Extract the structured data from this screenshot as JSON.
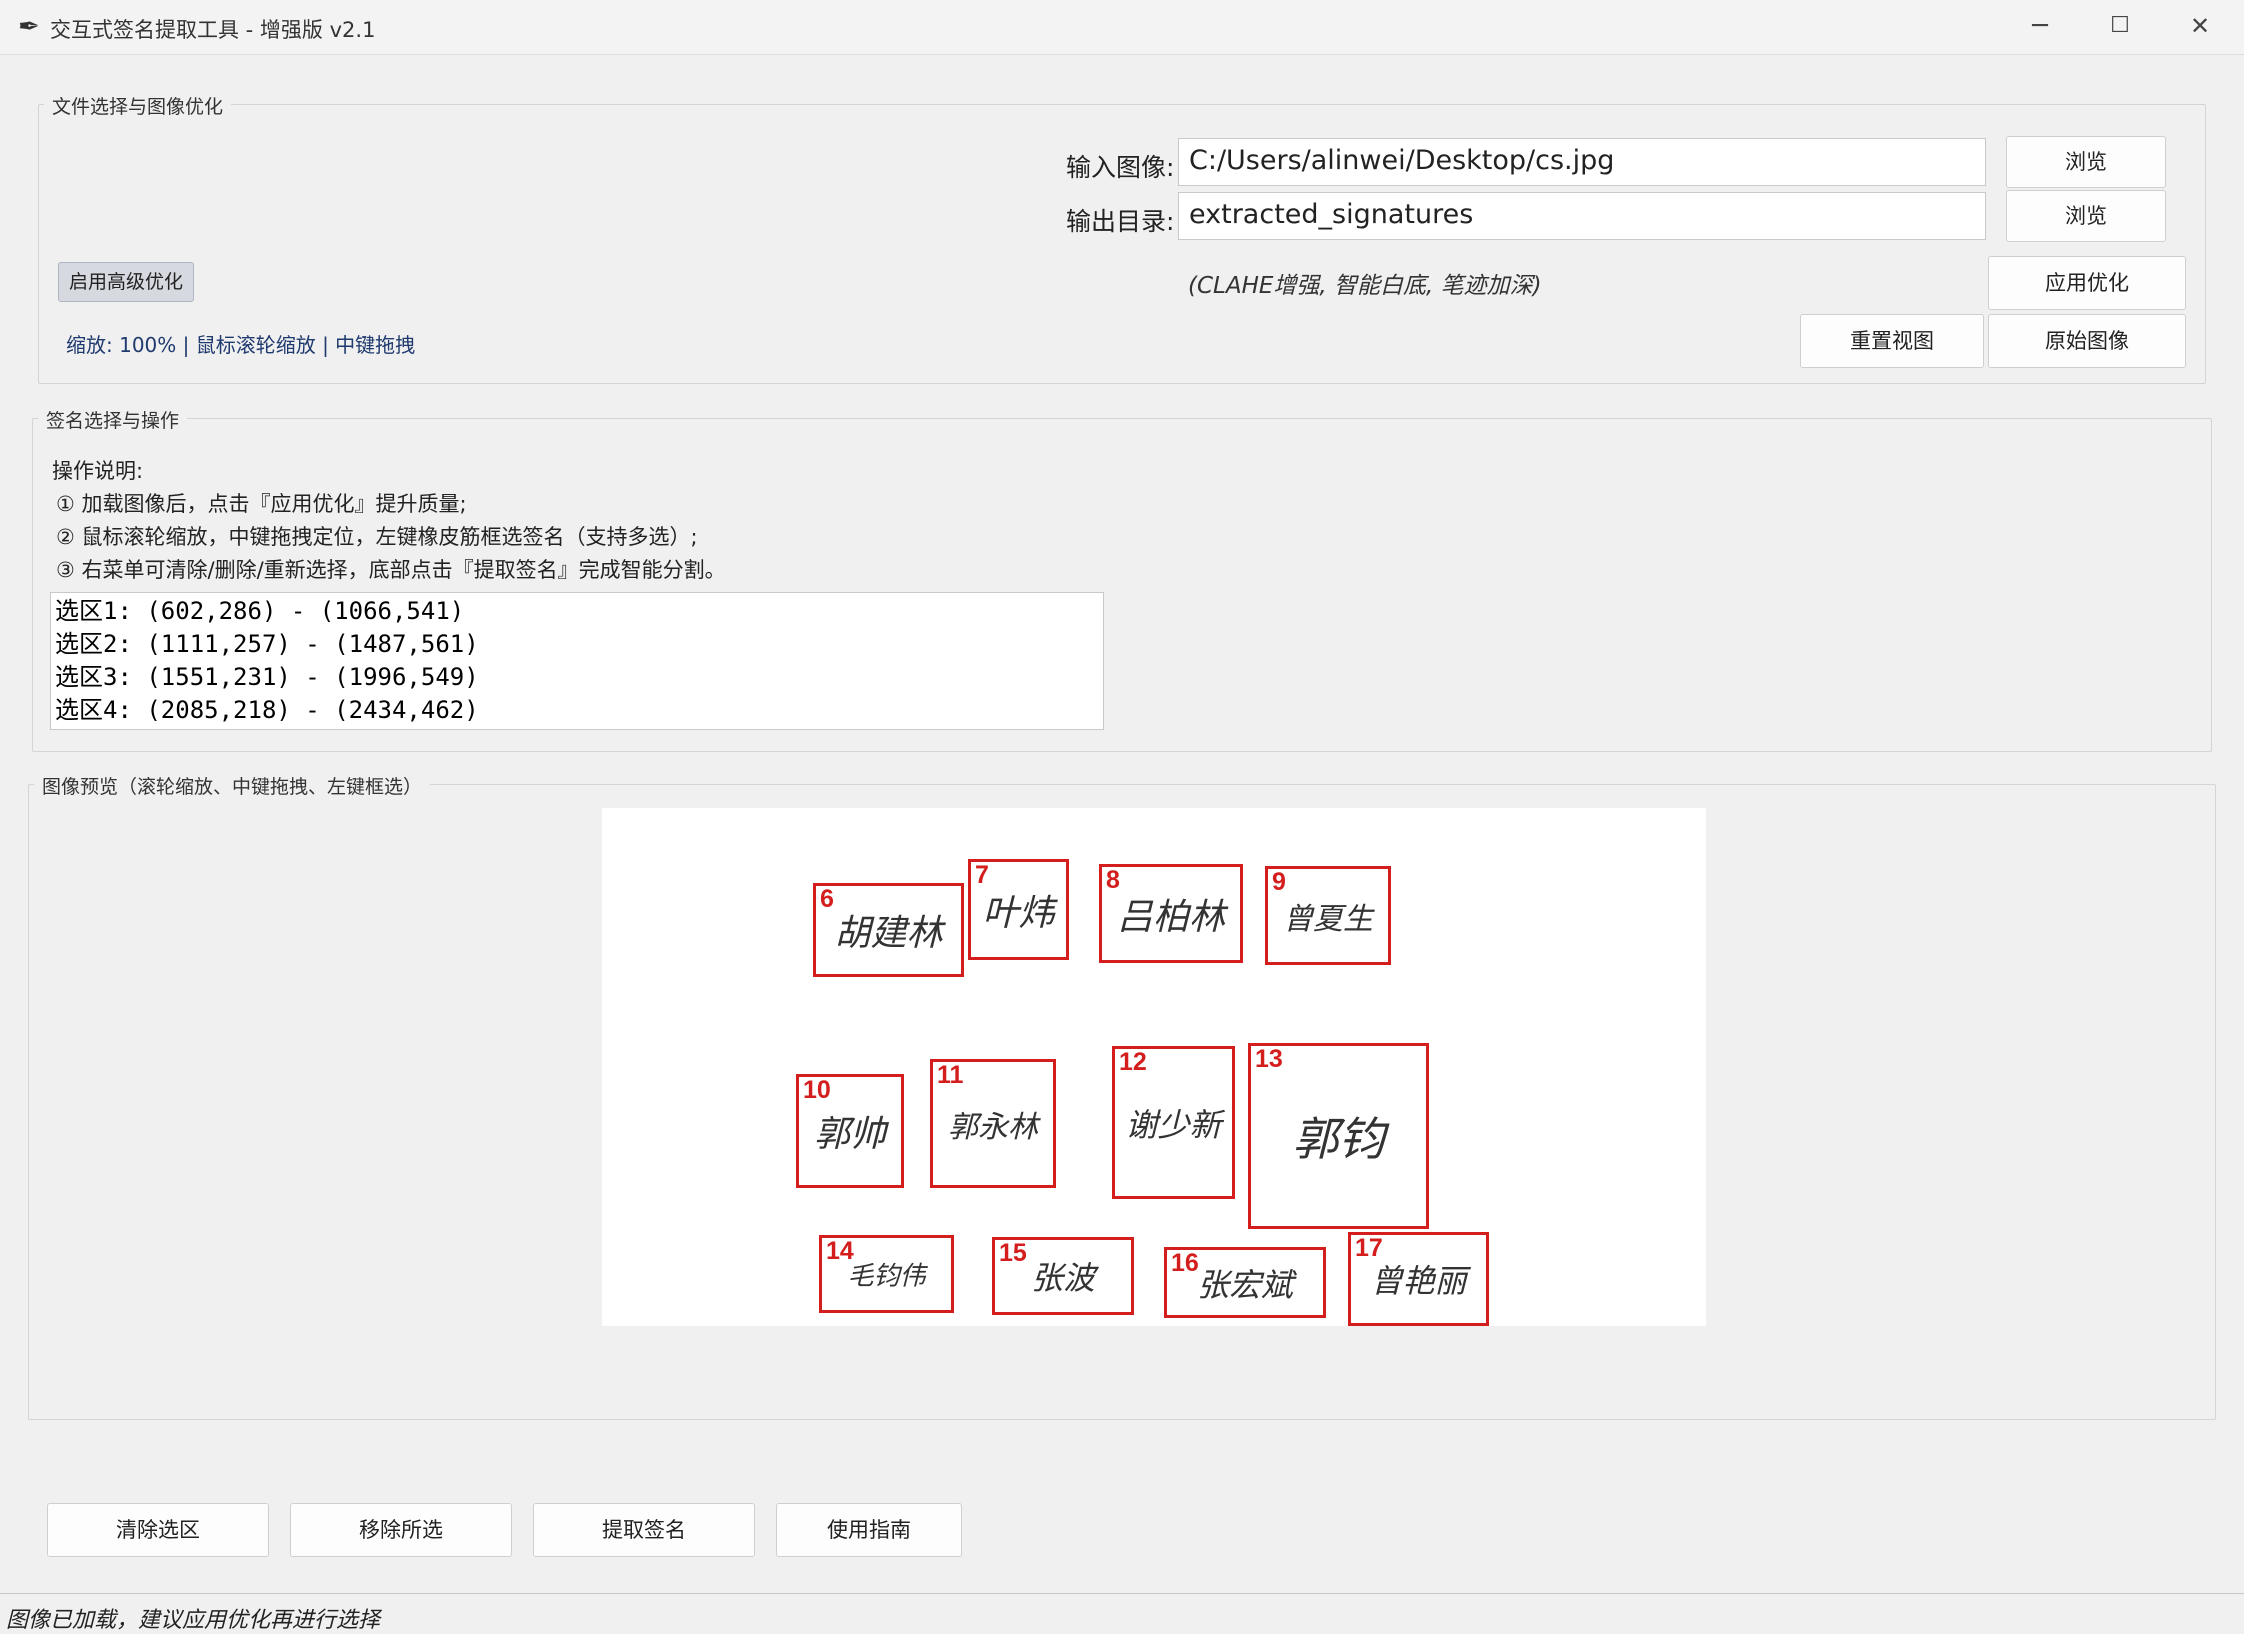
{
  "window": {
    "title": "交互式签名提取工具 - 增强版 v2.1",
    "minimize_glyph": "─",
    "maximize_glyph": "☐",
    "close_glyph": "✕",
    "app_icon": "feather-icon"
  },
  "file_section": {
    "title": "文件选择与图像优化",
    "input_label": "输入图像:",
    "input_value": "C:/Users/alinwei/Desktop/cs.jpg",
    "output_label": "输出目录:",
    "output_value": "extracted_signatures",
    "browse_label": "浏览",
    "advanced_toggle": "启用高级优化",
    "optimize_hint": "(CLAHE增强, 智能白底, 笔迹加深)",
    "apply_label": "应用优化",
    "zoom_info": "缩放: 100% | 鼠标滚轮缩放 | 中键拖拽",
    "reset_view_label": "重置视图",
    "original_label": "原始图像"
  },
  "selection_section": {
    "title": "签名选择与操作",
    "instructions_title": "操作说明:",
    "instructions": [
      "① 加载图像后，点击『应用优化』提升质量;",
      "② 鼠标滚轮缩放，中键拖拽定位，左键橡皮筋框选签名（支持多选）;",
      "③ 右菜单可清除/删除/重新选择，底部点击『提取签名』完成智能分割。"
    ],
    "selections": [
      "选区1: (602,286) - (1066,541)",
      "选区2: (1111,257) - (1487,561)",
      "选区3: (1551,231) - (1996,549)",
      "选区4: (2085,218) - (2434,462)"
    ]
  },
  "preview_section": {
    "title": "图像预览（滚轮缩放、中键拖拽、左键框选）",
    "signatures": [
      {
        "num": "6",
        "text": "胡建林"
      },
      {
        "num": "7",
        "text": "叶炜"
      },
      {
        "num": "8",
        "text": "吕柏林"
      },
      {
        "num": "9",
        "text": "曾夏生"
      },
      {
        "num": "10",
        "text": "郭帅"
      },
      {
        "num": "11",
        "text": "郭永林"
      },
      {
        "num": "12",
        "text": "谢少新"
      },
      {
        "num": "13",
        "text": "郭钧"
      },
      {
        "num": "14",
        "text": "毛钧伟"
      },
      {
        "num": "15",
        "text": "张波"
      },
      {
        "num": "16",
        "text": "张宏斌"
      },
      {
        "num": "17",
        "text": "曾艳丽"
      }
    ]
  },
  "actions": {
    "clear": "清除选区",
    "remove": "移除所选",
    "extract": "提取签名",
    "guide": "使用指南"
  },
  "status": {
    "text": "图像已加载，建议应用优化再进行选择"
  },
  "colors": {
    "selection_box": "#d41e1e",
    "background": "#f0f0f0"
  }
}
